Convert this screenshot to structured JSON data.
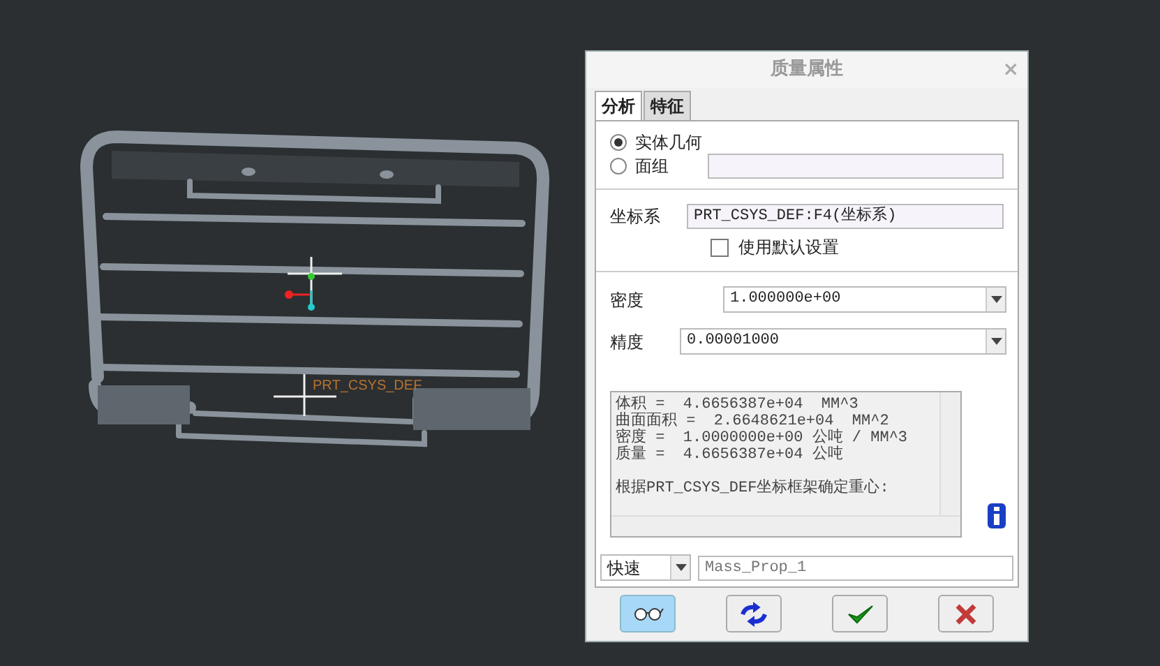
{
  "viewport": {
    "csys_label": "PRT_CSYS_DEF"
  },
  "dialog": {
    "title": "质量属性",
    "close": "×",
    "tabs": [
      {
        "label": "分析",
        "selected": true
      },
      {
        "label": "特征",
        "selected": false
      }
    ],
    "geometry_options": [
      {
        "label": "实体几何",
        "selected": true
      },
      {
        "label": "面组",
        "selected": false
      }
    ],
    "csys": {
      "label": "坐标系",
      "value": "PRT_CSYS_DEF:F4(坐标系)",
      "use_default": {
        "label": "使用默认设置",
        "checked": false
      }
    },
    "density": {
      "label": "密度",
      "value": "1.000000e+00"
    },
    "accuracy": {
      "label": "精度",
      "value": "0.00001000"
    },
    "results": [
      {
        "kind": "line",
        "text": "体积 =  4.6656387e+04  MM^3"
      },
      {
        "kind": "line",
        "text": "曲面面积 =  2.6648621e+04  MM^2"
      },
      {
        "kind": "line",
        "text": "密度 =  1.0000000e+00 公吨 / MM^3"
      },
      {
        "kind": "line",
        "text": "质量 =  4.6656387e+04 公吨"
      },
      {
        "kind": "paragraph",
        "text": "根据PRT_CSYS_DEF坐标框架确定重心:"
      }
    ],
    "mode": {
      "value": "快速"
    },
    "name_field": {
      "placeholder": "Mass_Prop_1"
    },
    "buttons": [
      {
        "kind": "glasses",
        "selected": true
      },
      {
        "kind": "repeat",
        "selected": false
      },
      {
        "kind": "ok",
        "selected": false
      },
      {
        "kind": "cancel",
        "selected": false
      }
    ]
  }
}
